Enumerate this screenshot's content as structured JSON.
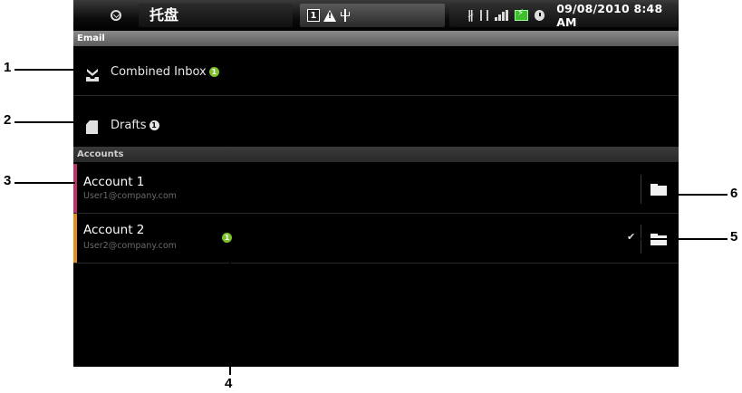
{
  "status_bar": {
    "title": "托盘",
    "sim_icon_text": "1",
    "time": "09/08/2010 8:48 AM"
  },
  "email_section": {
    "header": "Email",
    "items": [
      {
        "label": "Combined Inbox",
        "badge": "1",
        "icon": "combined-inbox-icon"
      },
      {
        "label": "Drafts",
        "badge": "1",
        "icon": "drafts-icon"
      }
    ]
  },
  "accounts_section": {
    "header": "Accounts",
    "accounts": [
      {
        "name": "Account 1",
        "email": "User1@company.com",
        "color": "#c0306a",
        "checked": false
      },
      {
        "name": "Account 2",
        "email": "User2@company.com",
        "color": "#e0901c",
        "badge": "1",
        "checked": true
      }
    ]
  },
  "callouts": [
    "1",
    "2",
    "3",
    "4",
    "5",
    "6"
  ],
  "colors": {
    "badge_green": "#7cc12b",
    "background": "#000000"
  }
}
